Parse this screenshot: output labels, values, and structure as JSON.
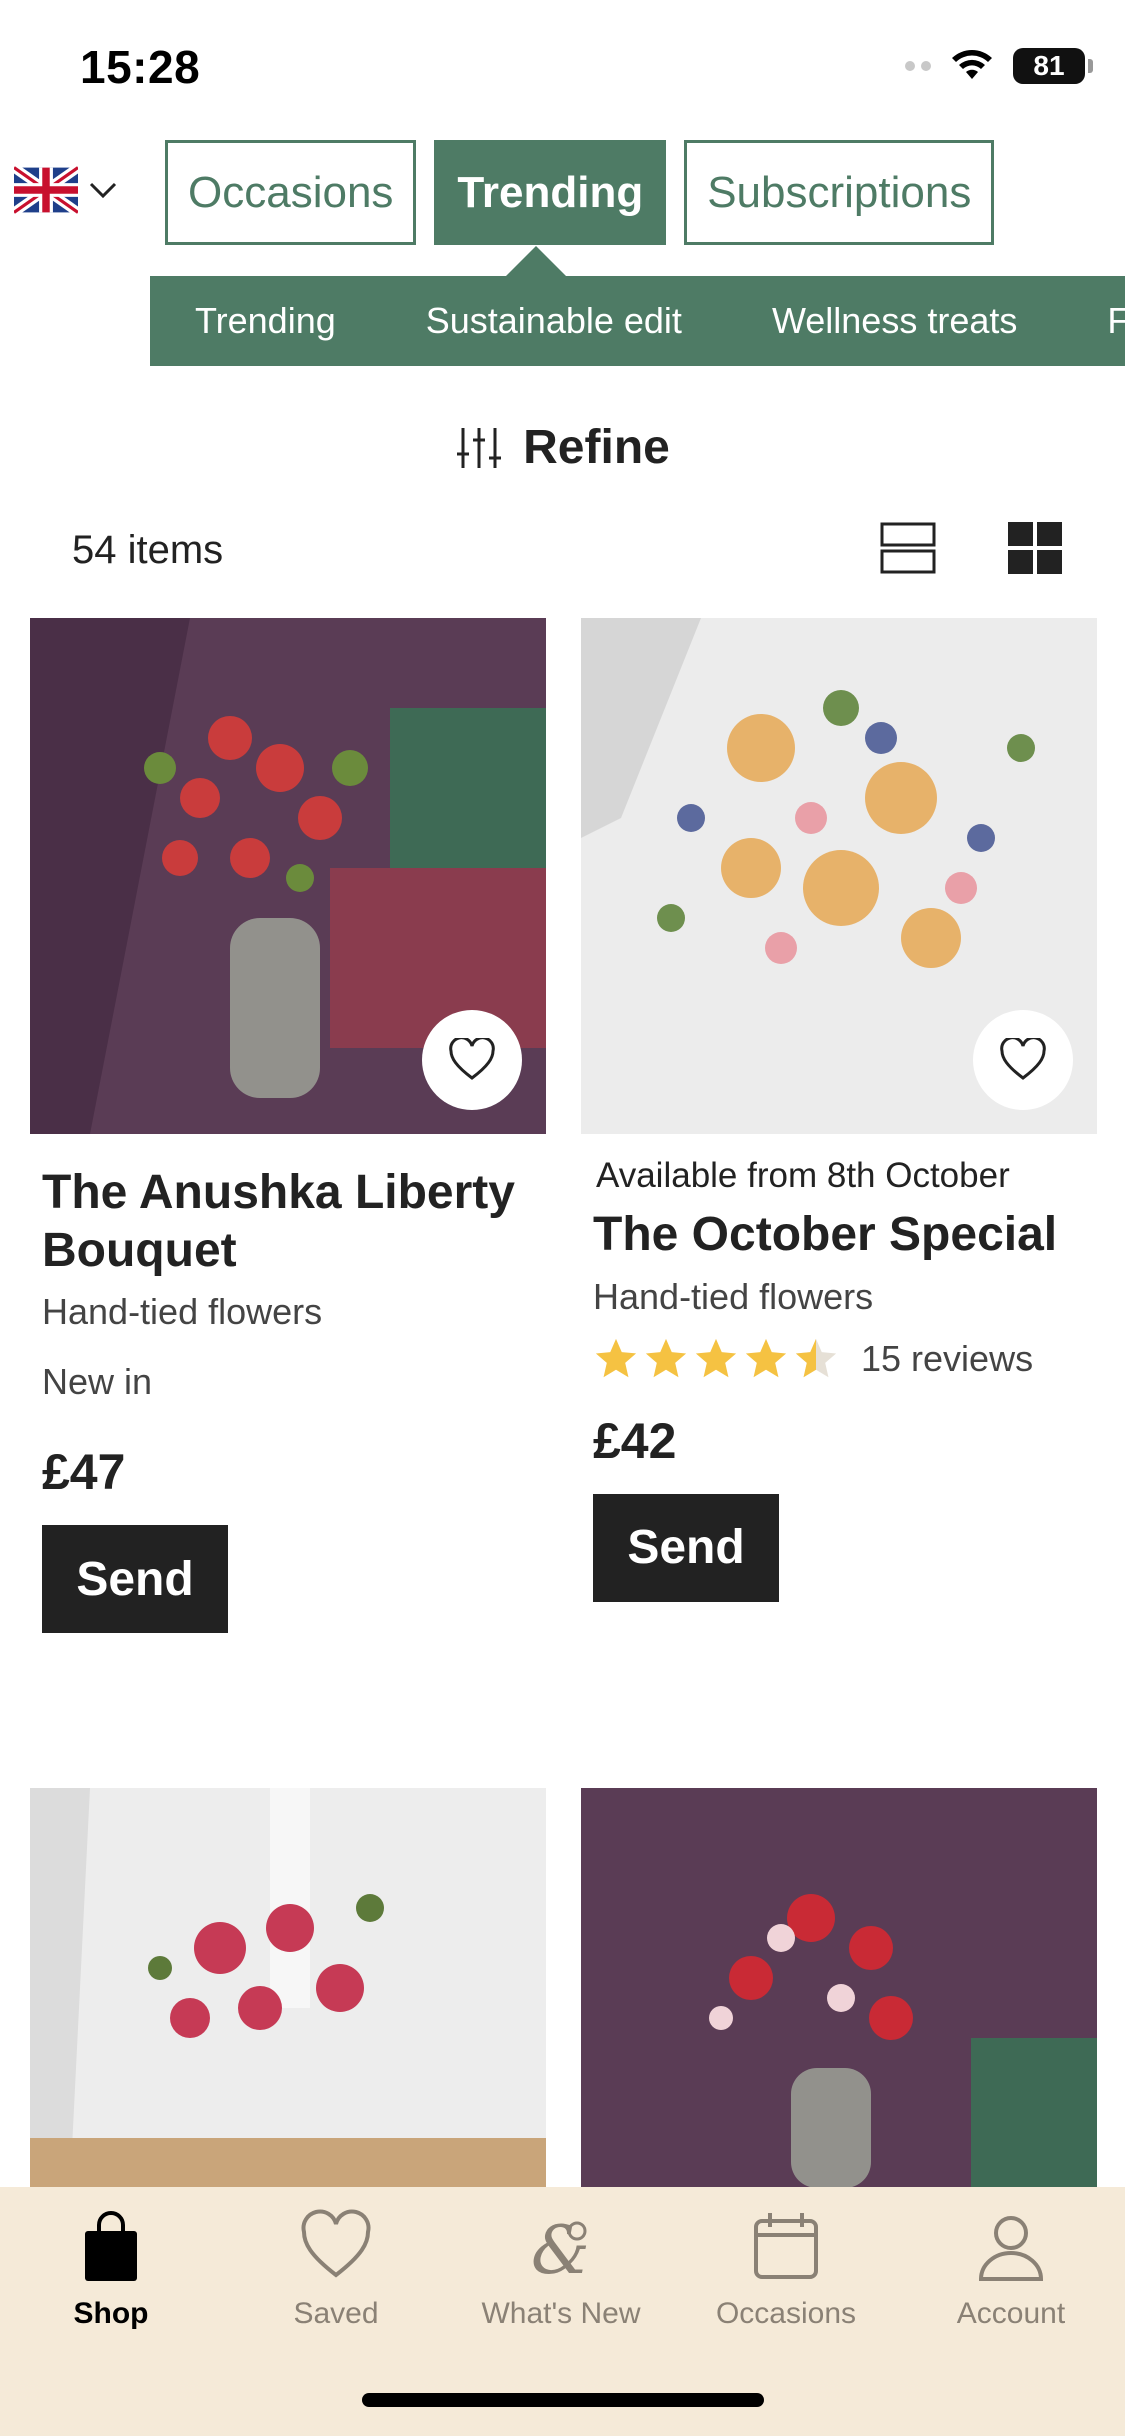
{
  "status_bar": {
    "time": "15:28",
    "battery": "81"
  },
  "country": {
    "flag": "uk-flag-icon"
  },
  "main_tabs": [
    {
      "label": "Occasions",
      "active": false
    },
    {
      "label": "Trending",
      "active": true
    },
    {
      "label": "Subscriptions",
      "active": false
    }
  ],
  "sub_nav": [
    "Trending",
    "Sustainable edit",
    "Wellness treats",
    "F"
  ],
  "refine": {
    "label": "Refine"
  },
  "results": {
    "count_label": "54 items"
  },
  "products": [
    {
      "availability": "",
      "title": "The Anushka Liberty Bouquet",
      "subtitle": "Hand-tied flowers",
      "tag": "New in",
      "rating": null,
      "reviews": "",
      "price": "£47",
      "button": "Send"
    },
    {
      "availability": "Available from 8th October",
      "title": "The October Special",
      "subtitle": "Hand-tied flowers",
      "tag": "",
      "rating": 4.5,
      "reviews": "15 reviews",
      "price": "£42",
      "button": "Send"
    }
  ],
  "tab_bar": [
    {
      "label": "Shop",
      "icon": "shopping-bag-icon",
      "active": true
    },
    {
      "label": "Saved",
      "icon": "heart-icon",
      "active": false
    },
    {
      "label": "What's New",
      "icon": "ampersand-floral-icon",
      "active": false
    },
    {
      "label": "Occasions",
      "icon": "calendar-icon",
      "active": false
    },
    {
      "label": "Account",
      "icon": "person-icon",
      "active": false
    }
  ],
  "colors": {
    "brand_green": "#4e7b65",
    "tab_bar_bg": "#f5ead8",
    "star": "#f5c242",
    "button_dark": "#222222"
  }
}
